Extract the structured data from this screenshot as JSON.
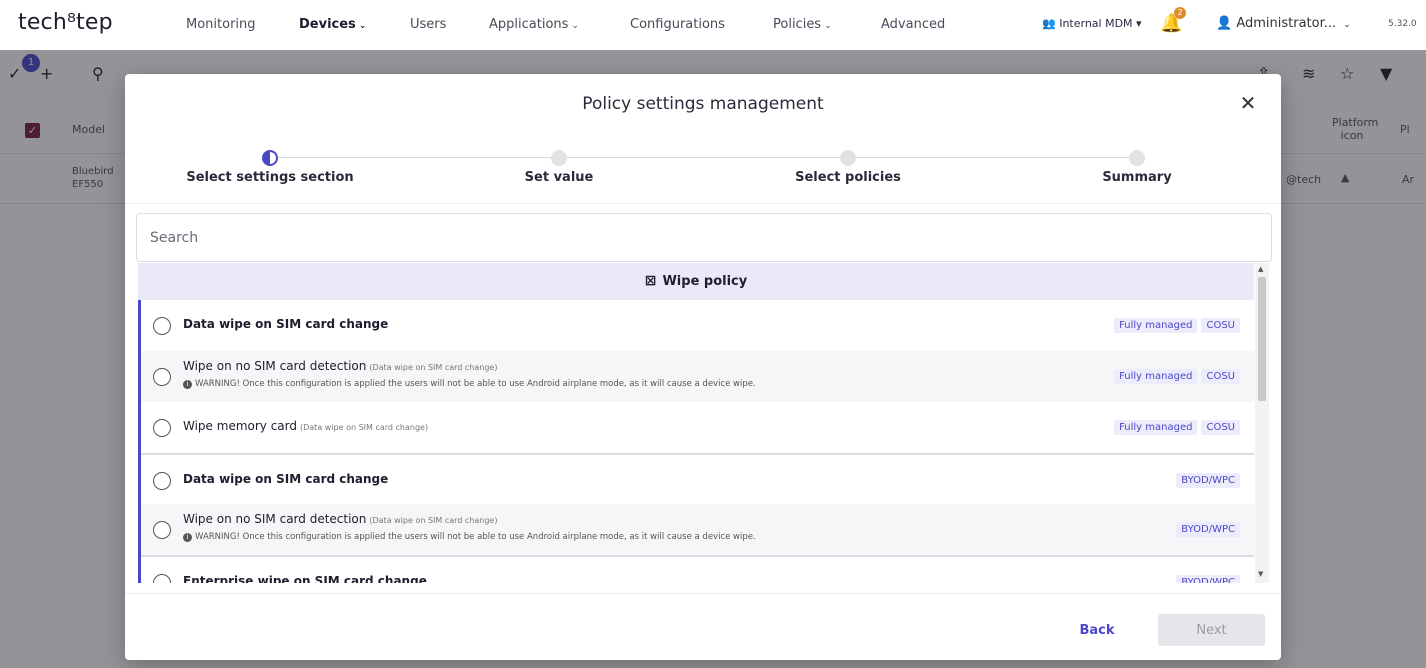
{
  "app": {
    "logo": "tech⁸tep",
    "version": "5.32.0"
  },
  "nav": {
    "items": [
      {
        "label": "Monitoring"
      },
      {
        "label": "Devices",
        "active": true,
        "dropdown": true
      },
      {
        "label": "Users"
      },
      {
        "label": "Applications",
        "dropdown": true
      },
      {
        "label": "Configurations"
      },
      {
        "label": "Policies",
        "dropdown": true
      },
      {
        "label": "Advanced"
      }
    ],
    "chevron": "⌄",
    "mdm_label": "Internal MDM",
    "notifications_count": "2",
    "admin_label": "Administrator..."
  },
  "background": {
    "selected_count": "1",
    "column_model": "Model",
    "column_platform_icon": "Platform icon",
    "column_pl": "Pl",
    "row_model_line1": "Bluebird",
    "row_model_line2": "EF550",
    "row_email_fragment": "@tech",
    "row_platform_fragment": "Ar"
  },
  "modal": {
    "title": "Policy settings management",
    "steps": [
      {
        "label": "Select settings section",
        "state": "active"
      },
      {
        "label": "Set value",
        "state": "pending"
      },
      {
        "label": "Select policies",
        "state": "pending"
      },
      {
        "label": "Summary",
        "state": "pending"
      }
    ],
    "search_placeholder": "Search",
    "section_title": "Wipe policy",
    "groups": [
      {
        "rows": [
          {
            "title": "Data wipe on SIM card change",
            "bold": true,
            "sub": "",
            "warning": "",
            "tags": [
              "Fully managed",
              "COSU"
            ]
          },
          {
            "title": "Wipe on no SIM card detection",
            "bold": false,
            "sub": "(Data wipe on SIM card change)",
            "warning": "WARNING! Once this configuration is applied the users will not be able to use Android airplane mode, as it will cause a device wipe.",
            "tags": [
              "Fully managed",
              "COSU"
            ]
          },
          {
            "title": "Wipe memory card",
            "bold": false,
            "sub": "(Data wipe on SIM card change)",
            "warning": "",
            "tags": [
              "Fully managed",
              "COSU"
            ]
          }
        ]
      },
      {
        "rows": [
          {
            "title": "Data wipe on SIM card change",
            "bold": true,
            "sub": "",
            "warning": "",
            "tags": [
              "BYOD/WPC"
            ]
          },
          {
            "title": "Wipe on no SIM card detection",
            "bold": false,
            "sub": "(Data wipe on SIM card change)",
            "warning": "WARNING! Once this configuration is applied the users will not be able to use Android airplane mode, as it will cause a device wipe.",
            "tags": [
              "BYOD/WPC"
            ]
          }
        ]
      },
      {
        "rows": [
          {
            "title": "Enterprise wipe on SIM card change",
            "bold": true,
            "sub": "",
            "warning": "",
            "tags": [
              "BYOD/WPC"
            ]
          }
        ]
      }
    ],
    "back_label": "Back",
    "next_label": "Next",
    "colors": {
      "accent": "#4b48c8",
      "tag_bg": "#ececfb",
      "section_bg": "#e9e9f8",
      "checkbox": "#7b1e3c"
    }
  }
}
